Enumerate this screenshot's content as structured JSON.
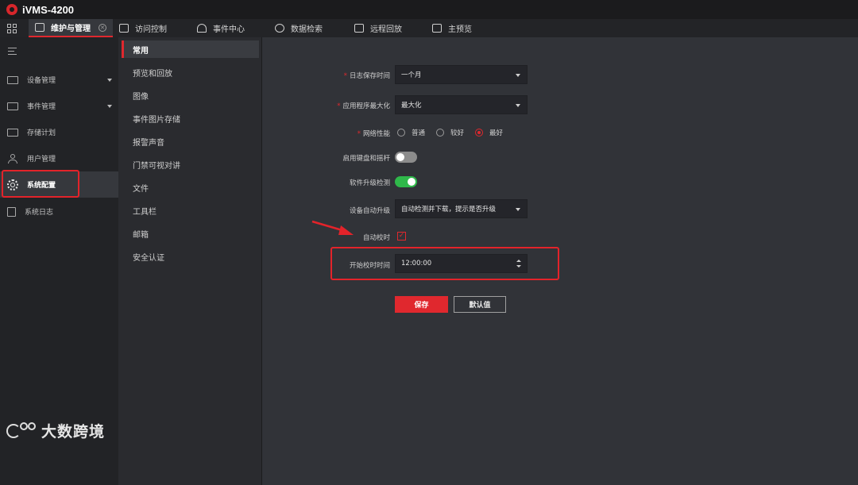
{
  "app": {
    "title": "iVMS-4200"
  },
  "tabs": [
    {
      "label": "维护与管理",
      "active": true
    },
    {
      "label": "访问控制"
    },
    {
      "label": "事件中心"
    },
    {
      "label": "数据检索"
    },
    {
      "label": "远程回放"
    },
    {
      "label": "主预览"
    }
  ],
  "sidebar": {
    "items": [
      {
        "label": "设备管理",
        "icon": "device-icon",
        "expandable": true
      },
      {
        "label": "事件管理",
        "icon": "event-icon",
        "expandable": true
      },
      {
        "label": "存储计划",
        "icon": "storage-icon"
      },
      {
        "label": "用户管理",
        "icon": "user-icon"
      },
      {
        "label": "系统配置",
        "icon": "gear-icon",
        "active": true
      },
      {
        "label": "系统日志",
        "icon": "log-icon"
      }
    ]
  },
  "submenu": {
    "items": [
      {
        "label": "常用",
        "active": true
      },
      {
        "label": "预览和回放"
      },
      {
        "label": "图像"
      },
      {
        "label": "事件图片存储"
      },
      {
        "label": "报警声音"
      },
      {
        "label": "门禁可视对讲"
      },
      {
        "label": "文件"
      },
      {
        "label": "工具栏"
      },
      {
        "label": "邮箱"
      },
      {
        "label": "安全认证"
      }
    ]
  },
  "form": {
    "log_retention": {
      "label": "日志保存时间",
      "value": "一个月"
    },
    "app_maximize": {
      "label": "应用程序最大化",
      "value": "最大化"
    },
    "network": {
      "label": "网络性能",
      "options": [
        "普通",
        "较好",
        "最好"
      ],
      "selected": "最好"
    },
    "keyboard_joystick": {
      "label": "启用键盘和摇杆",
      "enabled": false
    },
    "software_upgrade": {
      "label": "软件升级检测",
      "enabled": true
    },
    "device_upgrade": {
      "label": "设备自动升级",
      "value": "自动检测并下载，提示是否升级"
    },
    "auto_time": {
      "label": "自动校时",
      "checked": true
    },
    "time_start": {
      "label": "开始校时时间",
      "value": "12:00:00"
    },
    "save_label": "保存",
    "default_label": "默认值"
  },
  "watermark": {
    "text": "大数跨境"
  },
  "colors": {
    "accent": "#e0282e",
    "toggle_on": "#2fb84a",
    "annotation": "#e3232a"
  }
}
